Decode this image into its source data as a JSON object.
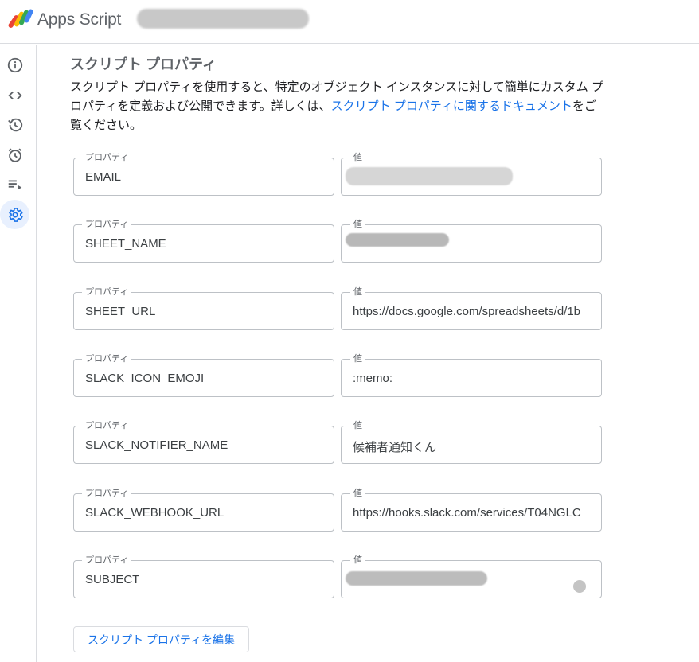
{
  "app": {
    "title": "Apps Script"
  },
  "sidebar": {
    "items": [
      {
        "icon": "info-icon",
        "name": "overview"
      },
      {
        "icon": "code-icon",
        "name": "editor"
      },
      {
        "icon": "history-icon",
        "name": "executions-history"
      },
      {
        "icon": "alarm-icon",
        "name": "triggers"
      },
      {
        "icon": "playlist-icon",
        "name": "executions"
      },
      {
        "icon": "gear-icon",
        "name": "settings",
        "active": true
      }
    ]
  },
  "main": {
    "title": "スクリプト プロパティ",
    "description_prefix": "スクリプト プロパティを使用すると、特定のオブジェクト インスタンスに対して簡単にカスタム プロパティを定義および公開できます。詳しくは、",
    "description_link": "スクリプト プロパティに関するドキュメント",
    "description_suffix": "をご覧ください。",
    "property_label": "プロパティ",
    "value_label": "値",
    "properties": [
      {
        "key": "EMAIL",
        "value": ""
      },
      {
        "key": "SHEET_NAME",
        "value": ""
      },
      {
        "key": "SHEET_URL",
        "value": "https://docs.google.com/spreadsheets/d/1b"
      },
      {
        "key": "SLACK_ICON_EMOJI",
        "value": ":memo:"
      },
      {
        "key": "SLACK_NOTIFIER_NAME",
        "value": "候補者通知くん"
      },
      {
        "key": "SLACK_WEBHOOK_URL",
        "value": "https://hooks.slack.com/services/T04NGLC"
      },
      {
        "key": "SUBJECT",
        "value": ""
      }
    ],
    "edit_button": "スクリプト プロパティを編集"
  },
  "colors": {
    "accent": "#1a73e8",
    "border": "#bdc1c6",
    "divider": "#dadce0",
    "active_nav_bg": "#e8f0fe",
    "icon": "#5f6368"
  }
}
